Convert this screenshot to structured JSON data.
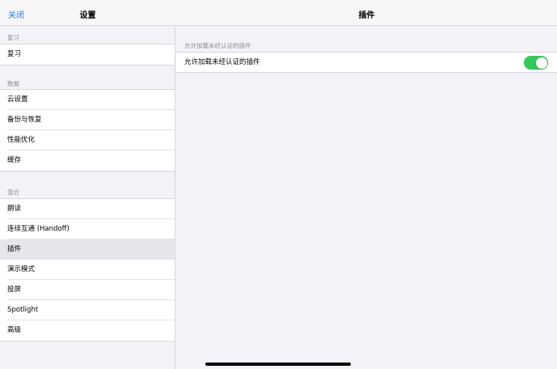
{
  "sidebar": {
    "close_label": "关闭",
    "title": "设置",
    "sections": [
      {
        "title": "复习",
        "items": [
          "复习"
        ]
      },
      {
        "title": "数据",
        "items": [
          "云设置",
          "备份与恢复",
          "性能优化",
          "缓存"
        ]
      },
      {
        "title": "混合",
        "items": [
          "朗读",
          "连续互通 (Handoff)",
          "插件",
          "演示模式",
          "投屏",
          "Spotlight",
          "高级"
        ]
      }
    ],
    "selected_item": "插件"
  },
  "main": {
    "title": "插件",
    "section_title": "允许加载未经认证的插件",
    "row_label": "允许加载未经认证的插件",
    "toggle_on": true
  },
  "colors": {
    "accent": "#1a7cf6",
    "toggle_on": "#34c759",
    "background": "#f2f2f7",
    "selected_row": "#e5e5ea"
  }
}
